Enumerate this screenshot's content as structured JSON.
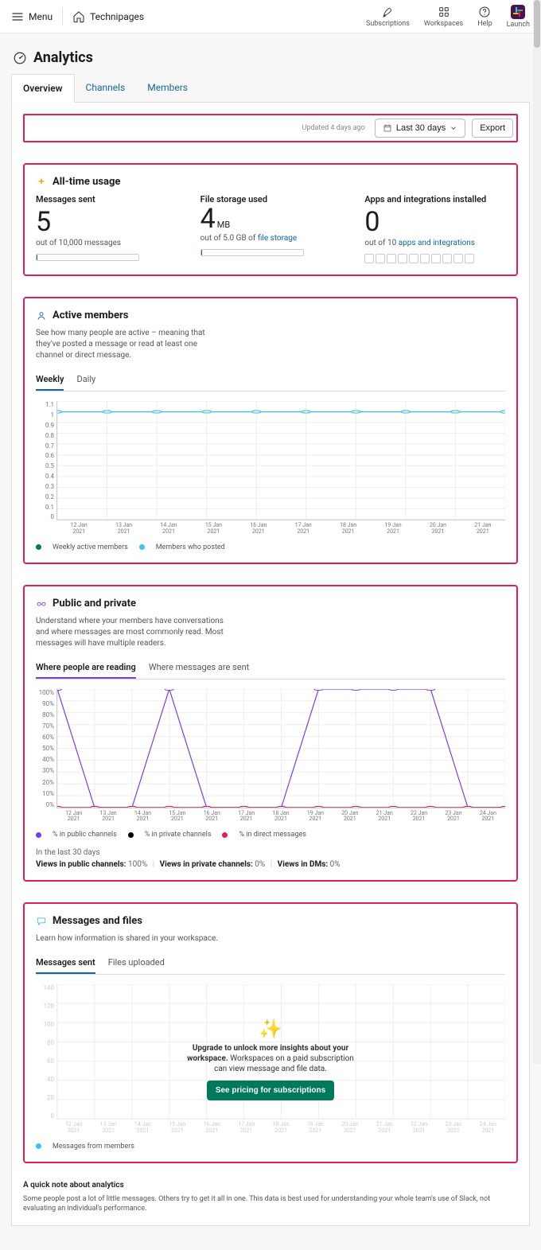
{
  "topbar": {
    "menu": "Menu",
    "site": "Technipages",
    "links": {
      "subscriptions": "Subscriptions",
      "workspaces": "Workspaces",
      "help": "Help",
      "launch": "Launch"
    }
  },
  "page_title": "Analytics",
  "tabs": {
    "overview": "Overview",
    "channels": "Channels",
    "members": "Members"
  },
  "toprow": {
    "updated": "Updated 4 days ago",
    "range": "Last 30 days",
    "export": "Export"
  },
  "alltime": {
    "title": "All-time usage",
    "messages": {
      "label": "Messages sent",
      "value": "5",
      "sub_prefix": "out of 10,000 messages"
    },
    "storage": {
      "label": "File storage used",
      "value": "4",
      "unit": "MB",
      "sub_prefix": "out of 5.0 GB of ",
      "sub_link": "file storage"
    },
    "apps": {
      "label": "Apps and integrations installed",
      "value": "0",
      "sub_prefix": "out of 10 ",
      "sub_link": "apps and integrations"
    }
  },
  "active": {
    "title": "Active members",
    "desc": "See how many people are active – meaning that they've posted a message or read at least one channel or direct message.",
    "tabs": {
      "weekly": "Weekly",
      "daily": "Daily"
    },
    "legend": {
      "a": "Weekly active members",
      "b": "Members who posted"
    }
  },
  "pubpriv": {
    "title": "Public and private",
    "desc": "Understand where your members have conversations and where messages are most commonly read. Most messages will have multiple readers.",
    "tabs": {
      "reading": "Where people are reading",
      "sent": "Where messages are sent"
    },
    "legend": {
      "pub": "% in public channels",
      "priv": "% in private channels",
      "dm": "% in direct messages"
    },
    "summary_caption": "In the last 30 days",
    "summaries": {
      "pub_label": "Views in public channels:",
      "pub_val": "100%",
      "priv_label": "Views in private channels:",
      "priv_val": "0%",
      "dm_label": "Views in DMs:",
      "dm_val": "0%"
    }
  },
  "msgs": {
    "title": "Messages and files",
    "desc": "Learn how information is shared in your workspace.",
    "tabs": {
      "sent": "Messages sent",
      "files": "Files uploaded"
    },
    "legend": {
      "a": "Messages from members"
    },
    "overlay_bold": "Upgrade to unlock more insights about your workspace.",
    "overlay_rest": "Workspaces on a paid subscription can view message and file data.",
    "overlay_btn": "See pricing for subscriptions"
  },
  "note": {
    "head": "A quick note about analytics",
    "body": "Some people post a lot of little messages. Others try to get it all in one. This data is best used for understanding your whole team's use of Slack, not evaluating an individual's performance."
  },
  "chart_data": [
    {
      "id": "active_members",
      "type": "line",
      "title": "Active members (Weekly)",
      "xlabel": "",
      "ylabel": "",
      "ylim": [
        0,
        1.1
      ],
      "yticks": [
        0,
        0.1,
        0.2,
        0.3,
        0.4,
        0.5,
        0.6,
        0.7,
        0.8,
        0.9,
        1,
        1.1
      ],
      "categories": [
        "12 Jan 2021",
        "13 Jan 2021",
        "14 Jan 2021",
        "15 Jan 2021",
        "16 Jan 2021",
        "17 Jan 2021",
        "18 Jan 2021",
        "19 Jan 2021",
        "20 Jan 2021",
        "21 Jan 2021"
      ],
      "series": [
        {
          "name": "Weekly active members",
          "color": "#007a5a",
          "values": [
            1,
            1,
            1,
            1,
            1,
            1,
            1,
            1,
            1,
            1
          ]
        },
        {
          "name": "Members who posted",
          "color": "#36c5f0",
          "values": [
            1,
            1,
            1,
            1,
            1,
            1,
            1,
            1,
            1,
            1
          ]
        }
      ]
    },
    {
      "id": "public_private",
      "type": "line",
      "title": "Where people are reading",
      "xlabel": "",
      "ylabel": "",
      "ylim": [
        0,
        100
      ],
      "yticks": [
        0,
        10,
        20,
        30,
        40,
        50,
        60,
        70,
        80,
        90,
        100
      ],
      "categories": [
        "12 Jan 2021",
        "13 Jan 2021",
        "14 Jan 2021",
        "15 Jan 2021",
        "16 Jan 2021",
        "17 Jan 2021",
        "18 Jan 2021",
        "19 Jan 2021",
        "20 Jan 2021",
        "21 Jan 2021",
        "22 Jan 2021",
        "23 Jan 2021",
        "24 Jan 2021"
      ],
      "series": [
        {
          "name": "% in public channels",
          "color": "#7c3aed",
          "values": [
            100,
            0,
            0,
            100,
            0,
            0,
            0,
            100,
            100,
            100,
            100,
            0,
            0
          ]
        },
        {
          "name": "% in private channels",
          "color": "#000000",
          "values": [
            0,
            0,
            0,
            0,
            0,
            0,
            0,
            0,
            0,
            0,
            0,
            0,
            0
          ]
        },
        {
          "name": "% in direct messages",
          "color": "#e01e5a",
          "values": [
            0,
            0,
            0,
            0,
            0,
            0,
            0,
            0,
            0,
            0,
            0,
            0,
            0
          ]
        }
      ]
    },
    {
      "id": "messages_files",
      "type": "line",
      "title": "Messages sent",
      "xlabel": "",
      "ylabel": "",
      "ylim": [
        0,
        140
      ],
      "yticks": [
        0,
        20,
        40,
        60,
        80,
        100,
        120,
        140
      ],
      "categories": [
        "12 Jan 2021",
        "13 Jan 2021",
        "14 Jan 2021",
        "15 Jan 2021",
        "16 Jan 2021",
        "17 Jan 2021",
        "18 Jan 2021",
        "19 Jan 2021",
        "20 Jan 2021",
        "21 Jan 2021",
        "22 Jan 2021",
        "23 Jan 2021",
        "24 Jan 2021"
      ],
      "series": [
        {
          "name": "Messages from members",
          "color": "#36c5f0",
          "values": null
        }
      ],
      "locked": true
    }
  ]
}
